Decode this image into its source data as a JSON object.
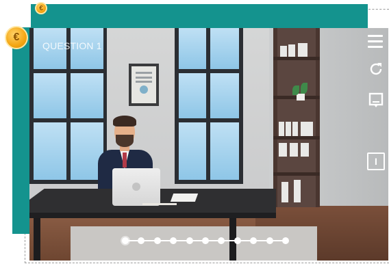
{
  "scene": {
    "question_label": "QUESTION 1"
  },
  "badges": [
    {
      "name": "coin-icon",
      "glyph": "€"
    },
    {
      "name": "coin-icon",
      "glyph": "€"
    }
  ],
  "toolbar": {
    "menu_icon": "hamburger-menu-icon",
    "refresh_icon": "refresh-icon",
    "note_icon": "note-icon",
    "info_icon": "info-dialog-icon",
    "info_glyph": "I"
  },
  "progress": {
    "total_steps": 11,
    "current_step": 1
  },
  "colors": {
    "teal": "#14938e",
    "coin": "#f4a613"
  }
}
